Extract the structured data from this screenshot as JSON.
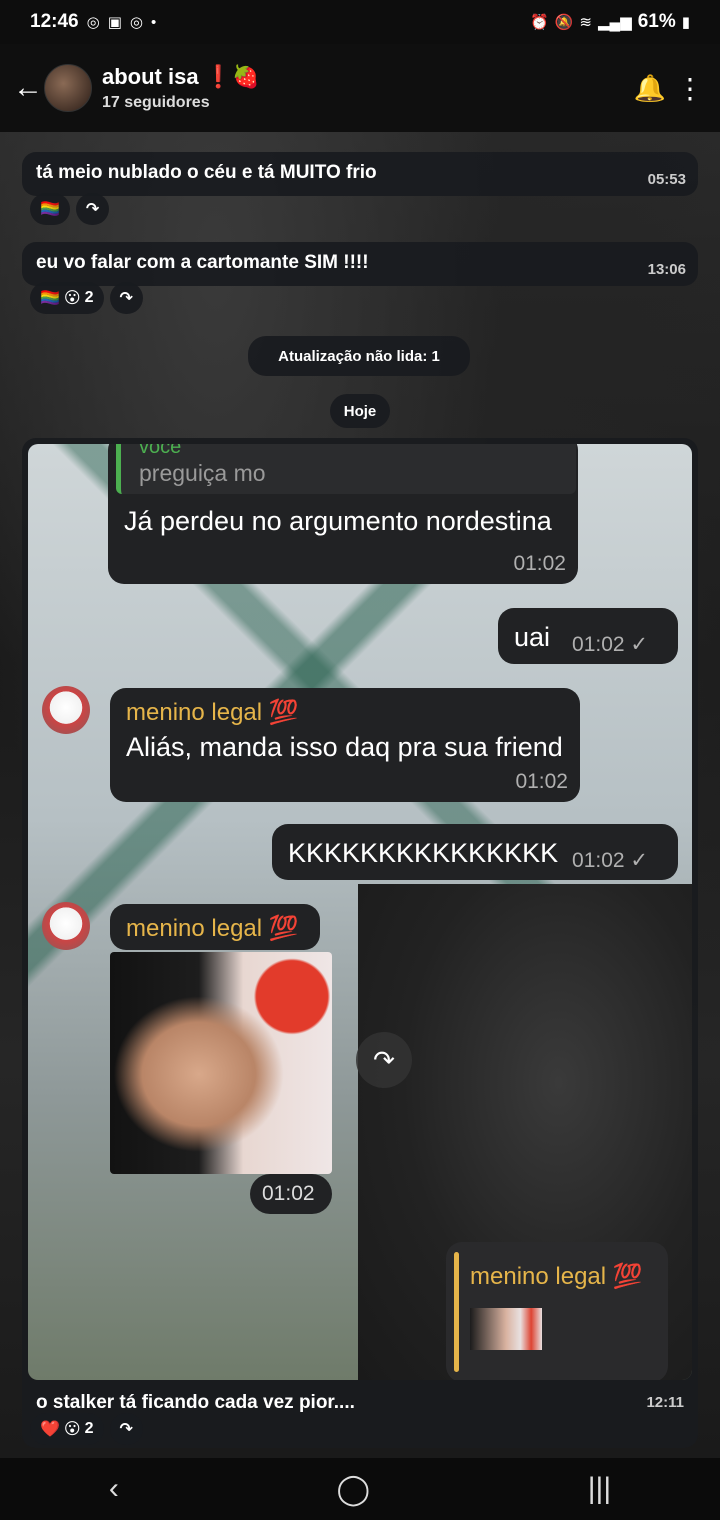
{
  "status": {
    "time": "12:46",
    "left_icons": [
      "whatsapp-icon",
      "gallery-icon",
      "whatsapp-icon"
    ],
    "battery": "61%"
  },
  "header": {
    "title": "about isa ❗🍓",
    "subtitle": "17 seguidores"
  },
  "posts": [
    {
      "text": "tá meio nublado o céu e tá MUITO frio",
      "time": "05:53",
      "reactions": [
        "🏳️‍🌈"
      ]
    },
    {
      "text": "eu vo falar com a cartomante SIM !!!!",
      "time": "13:06",
      "reactions": [
        "🏳️‍🌈",
        "😮"
      ],
      "reaction_count": "2"
    }
  ],
  "unread_label": "Atualização não lida: 1",
  "date_label": "Hoje",
  "screenshot": {
    "quote_sender": "você",
    "quote_text": "preguiça mo",
    "messages": [
      {
        "text": "Já perdeu no argumento nordestina",
        "time": "01:02"
      },
      {
        "text": "uai",
        "time": "01:02 ✓"
      },
      {
        "sender": "menino legal 💯",
        "text": "Aliás, manda isso daq pra sua friend",
        "time": "01:02"
      },
      {
        "text": "KKKKKKKKKKKKKKK",
        "time": "01:02 ✓"
      },
      {
        "sender": "menino legal 💯",
        "time": "01:02"
      }
    ],
    "reply_sender": "menino legal 💯"
  },
  "last_post": {
    "text": "o stalker tá ficando cada vez pior....",
    "time": "12:11",
    "reactions": [
      "❤️",
      "😮"
    ],
    "reaction_count": "2"
  }
}
